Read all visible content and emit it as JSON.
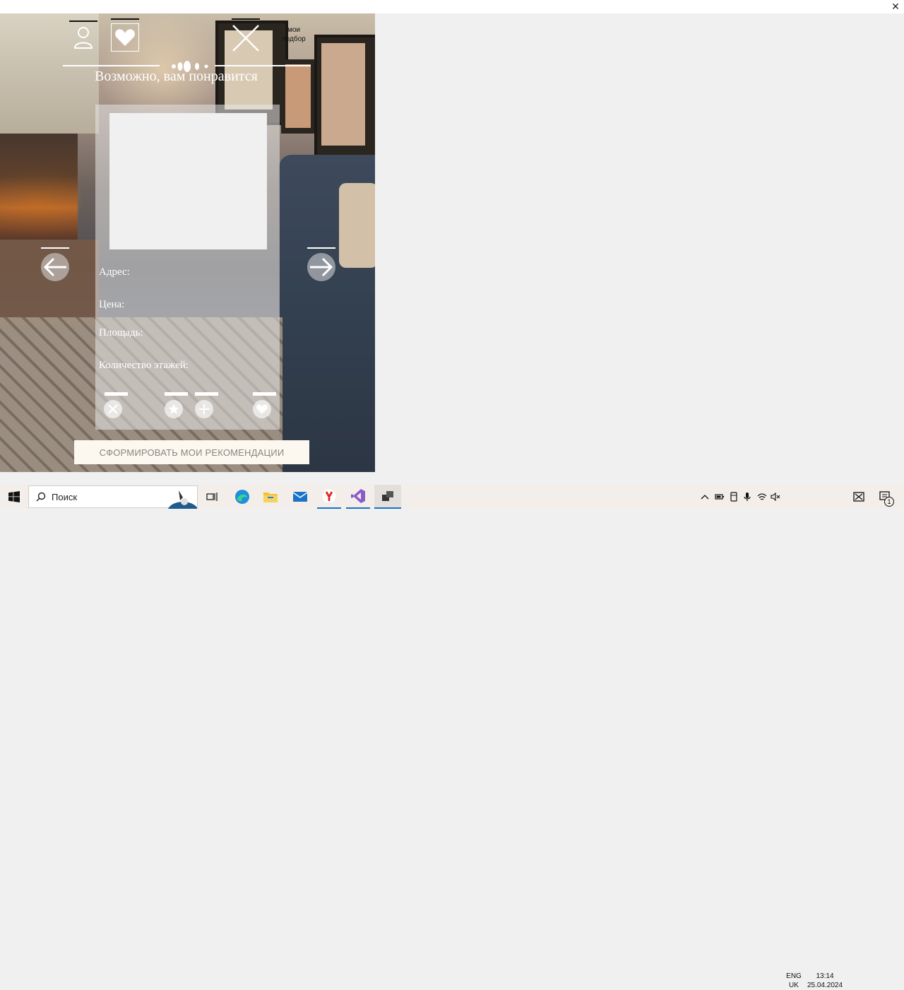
{
  "window": {
    "close_symbol": "✕"
  },
  "nav": {
    "profile_icon": "profile-icon",
    "favorites_icon": "heart-icon",
    "close_icon": "close-icon",
    "my_picks_label": "мои подбор"
  },
  "title": "Возможно, вам понравится",
  "card": {
    "fields": {
      "address": "Адрес:",
      "price": "Цена:",
      "area": "Площадь:",
      "floors": "Количество этажей:"
    },
    "actions": [
      "dismiss-icon",
      "star-icon",
      "add-icon",
      "heart-icon"
    ]
  },
  "arrows": {
    "prev": "arrow-left-icon",
    "next": "arrow-right-icon"
  },
  "cta_label": "СФОРМИРОВАТЬ МОИ РЕКОМЕНДАЦИИ",
  "taskbar": {
    "search_placeholder": "Поиск",
    "lang_top": "ENG",
    "lang_bottom": "UK",
    "time": "13:14",
    "date": "25.04.2024",
    "notification_count": "1"
  },
  "colors": {
    "card_overlay": "#e6e6e6",
    "cta_bg": "#fcf8ef",
    "cta_text": "#8a8580",
    "page_bg": "#f0f0f0"
  }
}
